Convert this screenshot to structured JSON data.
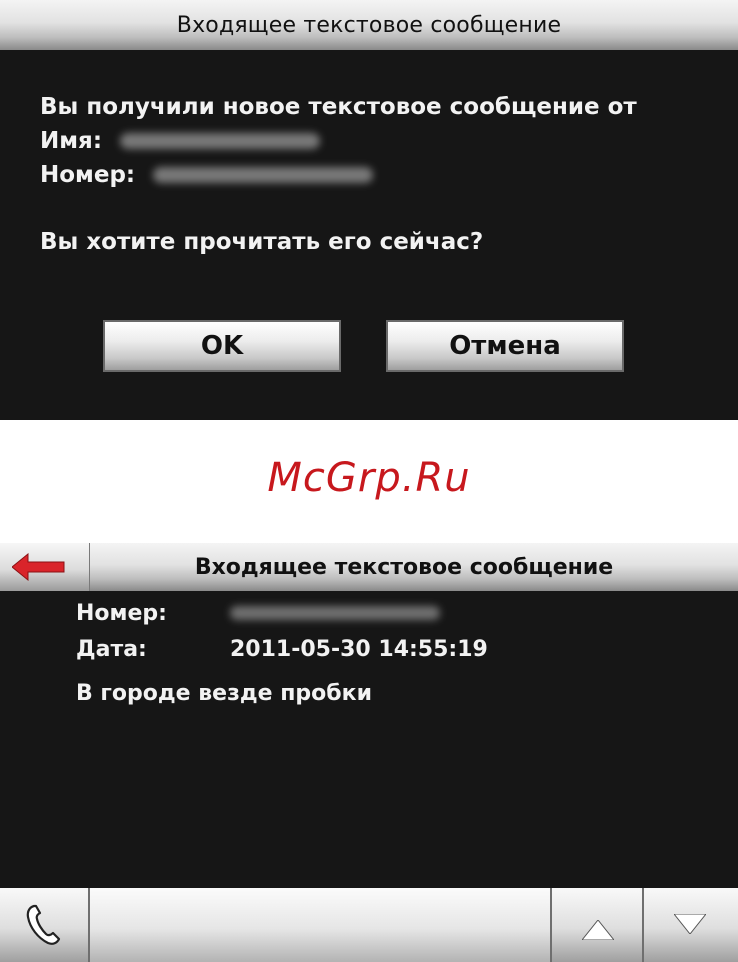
{
  "dialog": {
    "title": "Входящее текстовое сообщение",
    "line1": "Вы получили новое текстовое сообщение от",
    "name_label": "Имя:",
    "number_label": "Номер:",
    "question": "Вы хотите прочитать его сейчас?",
    "ok_label": "OK",
    "cancel_label": "Отмена"
  },
  "watermark": "McGrp.Ru",
  "message_view": {
    "title": "Входящее текстовое сообщение",
    "number_label": "Номер:",
    "date_label": "Дата:",
    "date_value": "2011-05-30 14:55:19",
    "body": "В городе везде пробки"
  },
  "icons": {
    "back": "back-arrow-icon",
    "call": "phone-icon",
    "up": "arrow-up-icon",
    "down": "arrow-down-icon"
  },
  "colors": {
    "screen_bg": "#161616",
    "text": "#f2f2f2",
    "back_arrow": "#d9242a",
    "watermark": "#c7181d"
  }
}
